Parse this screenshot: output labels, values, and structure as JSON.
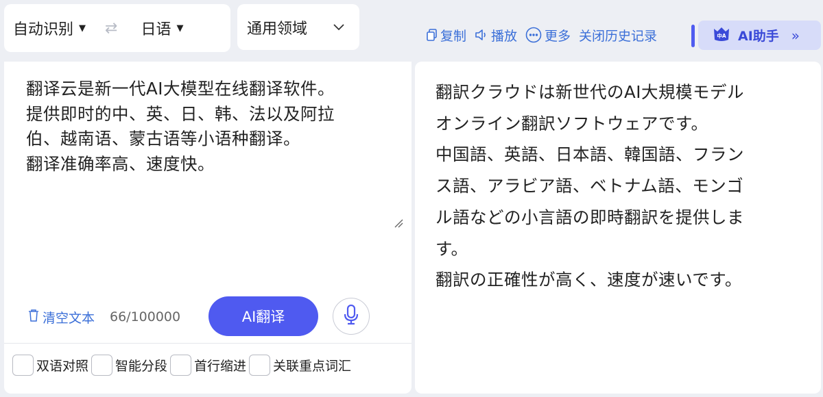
{
  "language_bar": {
    "source_language": "自动识别",
    "target_language": "日语",
    "swap_icon": "swap-arrows-icon"
  },
  "domain_select": {
    "label": "通用领域"
  },
  "toolbar": {
    "copy_label": "复制",
    "play_label": "播放",
    "more_label": "更多",
    "history_label": "关闭历史记录"
  },
  "ai_assistant": {
    "label": "AI助手",
    "avatar_text": "中A"
  },
  "source": {
    "lines": [
      "翻译云是新一代AI大模型在线翻译软件。",
      "提供即时的中、英、日、韩、法以及阿拉",
      "伯、越南语、蒙古语等小语种翻译。",
      "翻译准确率高、速度快。"
    ],
    "clear_label": "清空文本",
    "char_count": "66/100000",
    "translate_button": "AI翻译"
  },
  "options": [
    {
      "label": "双语对照",
      "checked": false
    },
    {
      "label": "智能分段",
      "checked": false
    },
    {
      "label": "首行缩进",
      "checked": false
    },
    {
      "label": "关联重点词汇",
      "checked": false
    }
  ],
  "target": {
    "lines": [
      "翻訳クラウドは新世代のAI大規模モデル",
      "オンライン翻訳ソフトウェアです。",
      "中国語、英語、日本語、韓国語、フラン",
      "ス語、アラビア語、ベトナム語、モンゴ",
      "ル語などの小言語の即時翻訳を提供しま",
      "す。",
      "翻訳の正確性が高く、速度が速いです。"
    ]
  },
  "colors": {
    "accent": "#4f5af0",
    "link": "#3b6fd8",
    "background": "#edeff4",
    "ai_assist_bg": "#d7dcf9"
  }
}
